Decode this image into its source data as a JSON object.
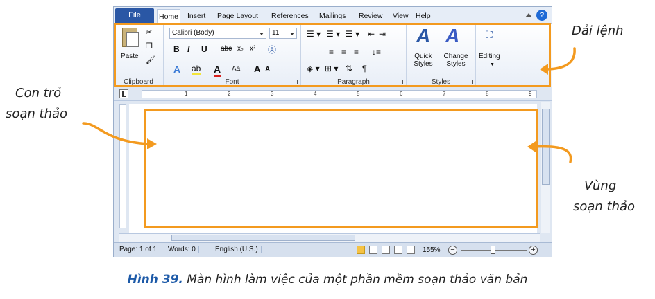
{
  "tabs": {
    "file": "File",
    "items": [
      "Home",
      "Insert",
      "Page Layout",
      "References",
      "Mailings",
      "Review",
      "View",
      "Help"
    ]
  },
  "ribbon": {
    "clipboard": {
      "paste": "Paste",
      "label": "Clipboard"
    },
    "font": {
      "name": "Calibri (Body)",
      "size": "11",
      "label": "Font"
    },
    "paragraph": {
      "label": "Paragraph"
    },
    "styles": {
      "quick": "Quick\nStyles",
      "change": "Change\nStyles",
      "label": "Styles"
    },
    "editing": {
      "label": "Editing"
    }
  },
  "status_bar": {
    "page": "Page: 1 of 1",
    "words": "Words: 0",
    "language": "English (U.S.)",
    "zoom": "155%"
  },
  "callouts": {
    "ribbon": "Dải lệnh",
    "cursor_line1": "Con trỏ",
    "cursor_line2": "soạn thảo",
    "area_line1": "Vùng",
    "area_line2": "soạn thảo"
  },
  "caption": {
    "figure": "Hình 39.",
    "text": "Màn hình làm việc của một phần mềm soạn thảo văn bản"
  },
  "colors": {
    "highlight": "#f39a1f",
    "file_tab": "#2a57a5",
    "caption_label": "#1d5aa8"
  }
}
